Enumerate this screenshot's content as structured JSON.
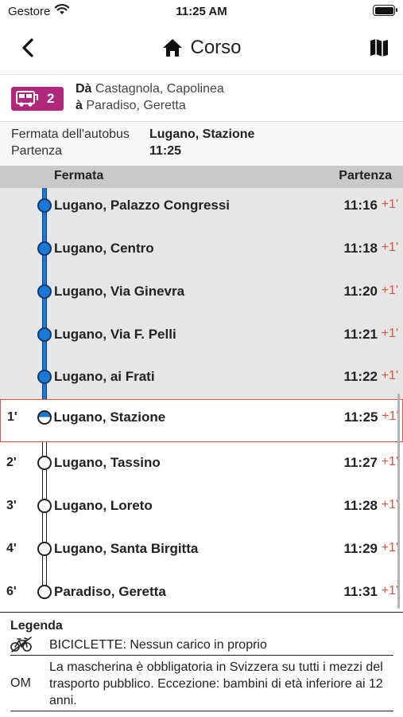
{
  "status_bar": {
    "carrier": "Gestore",
    "time": "11:25 AM"
  },
  "nav": {
    "title": "Corso",
    "back_icon": "chevron-left-icon",
    "home_icon": "home-icon",
    "map_icon": "map-icon"
  },
  "route": {
    "line_number": "2",
    "line_color": "#b0277c",
    "from_prefix": "Dà",
    "from": "Castagnola, Capolinea",
    "to_prefix": "à",
    "to": "Paradiso, Geretta"
  },
  "stop_info": {
    "stop_label": "Fermata dell'autobus",
    "stop_value": "Lugano, Stazione",
    "departure_label": "Partenza",
    "departure_value": "11:25"
  },
  "table": {
    "col_stop": "Fermata",
    "col_departure": "Partenza"
  },
  "stops": [
    {
      "name": "Lugano, Palazzo Congressi",
      "time": "11:16",
      "delay": "+1'",
      "minutes": "",
      "state": "passed"
    },
    {
      "name": "Lugano, Centro",
      "time": "11:18",
      "delay": "+1'",
      "minutes": "",
      "state": "passed"
    },
    {
      "name": "Lugano, Via Ginevra",
      "time": "11:20",
      "delay": "+1'",
      "minutes": "",
      "state": "passed"
    },
    {
      "name": "Lugano, Via F. Pelli",
      "time": "11:21",
      "delay": "+1'",
      "minutes": "",
      "state": "passed"
    },
    {
      "name": "Lugano, ai Frati",
      "time": "11:22",
      "delay": "+1'",
      "minutes": "",
      "state": "passed"
    },
    {
      "name": "Lugano, Stazione",
      "time": "11:25",
      "delay": "+1'",
      "minutes": "1'",
      "state": "current"
    },
    {
      "name": "Lugano, Tassino",
      "time": "11:27",
      "delay": "+1'",
      "minutes": "2'",
      "state": "upcoming"
    },
    {
      "name": "Lugano, Loreto",
      "time": "11:28",
      "delay": "+1'",
      "minutes": "3'",
      "state": "upcoming"
    },
    {
      "name": "Lugano, Santa Birgitta",
      "time": "11:29",
      "delay": "+1'",
      "minutes": "4'",
      "state": "upcoming"
    },
    {
      "name": "Paradiso, Geretta",
      "time": "11:31",
      "delay": "+1'",
      "minutes": "6'",
      "state": "upcoming"
    }
  ],
  "legend": {
    "title": "Legenda",
    "items": [
      {
        "icon": "bicycle-icon",
        "text": "BICICLETTE: Nessun carico in proprio"
      },
      {
        "code": "OM",
        "text": "La mascherina è obbligatoria in Svizzera su tutti i mezzi del trasporto pubblico. Eccezione: bambini di età inferiore ai 12 anni."
      }
    ]
  },
  "colors": {
    "passed_line": "#1a78d6",
    "delay": "#e05540",
    "current_border": "#e05540"
  }
}
